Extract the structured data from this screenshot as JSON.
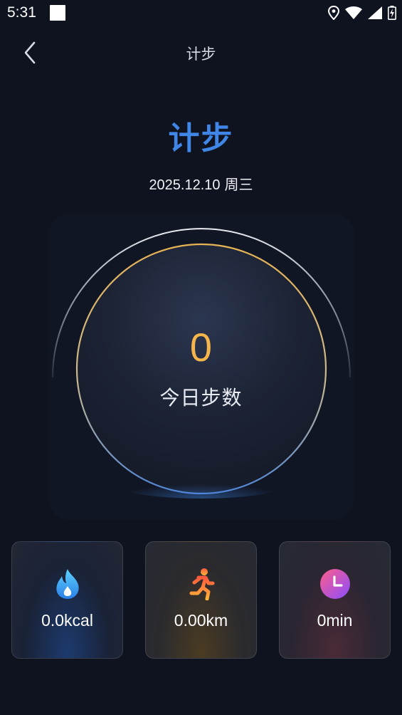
{
  "status_bar": {
    "time": "5:31",
    "icons": [
      "notification-square-icon",
      "location-icon",
      "wifi-icon",
      "signal-icon",
      "battery-charging-icon"
    ]
  },
  "header": {
    "title": "计步",
    "back_icon": "chevron-left-icon"
  },
  "main": {
    "title": "计步",
    "date": "2025.12.10",
    "weekday": "周三",
    "step_count": "0",
    "step_label": "今日步数"
  },
  "stats": [
    {
      "icon": "flame-icon",
      "value": "0.0kcal"
    },
    {
      "icon": "running-person-icon",
      "value": "0.00km"
    },
    {
      "icon": "clock-icon",
      "value": "0min"
    }
  ],
  "colors": {
    "background": "#0f1320",
    "title_blue": "#3f86e6",
    "step_orange": "#f5b54a"
  }
}
